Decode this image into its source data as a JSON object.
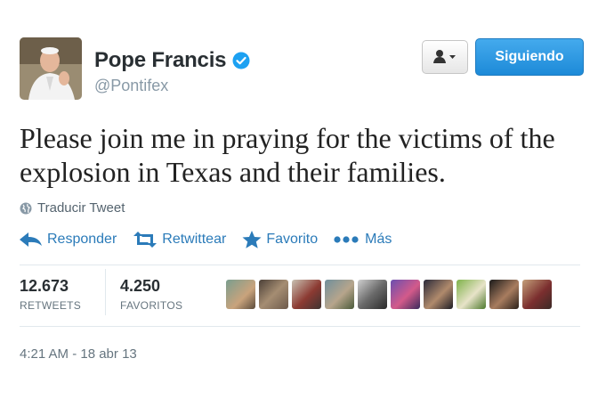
{
  "user": {
    "name": "Pope Francis",
    "handle": "@Pontifex",
    "verified": true
  },
  "follow_button": {
    "label": "Siguiendo"
  },
  "tweet": {
    "text": "Please join me in praying for the victims of the explosion in Texas and their families."
  },
  "translate": {
    "label": "Traducir Tweet",
    "icon": "globe-icon"
  },
  "actions": [
    {
      "label": "Responder",
      "icon": "reply-icon"
    },
    {
      "label": "Retwittear",
      "icon": "retweet-icon"
    },
    {
      "label": "Favorito",
      "icon": "star-icon"
    },
    {
      "label": "Más",
      "icon": "more-dots-icon"
    }
  ],
  "stats": {
    "retweets": {
      "count": "12.673",
      "label": "RETWEETS"
    },
    "favorites": {
      "count": "4.250",
      "label": "FAVORITOS"
    }
  },
  "timestamp": "4:21 AM - 18 abr 13",
  "colors": {
    "accent": "#2b7bb9",
    "follow_button": "#1d8ad8",
    "verified": "#1da1f2"
  }
}
